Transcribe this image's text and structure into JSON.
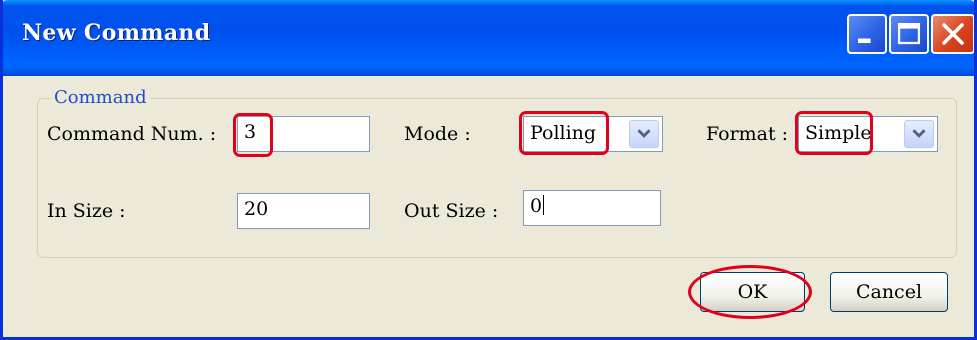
{
  "window": {
    "title": "New Command",
    "controls": [
      "minimize-icon",
      "maximize-icon",
      "close-icon"
    ],
    "colors": {
      "titlebar": "#0050ee",
      "frame": "#ece9d8",
      "highlight": "#e3001b"
    }
  },
  "group": {
    "label": "Command",
    "command_num": {
      "label": "Command Num. :",
      "value": "3"
    },
    "mode": {
      "label": "Mode :",
      "value": "Polling"
    },
    "format": {
      "label": "Format :",
      "value": "Simple"
    },
    "in_size": {
      "label": "In Size :",
      "value": "20"
    },
    "out_size": {
      "label": "Out Size :",
      "value": "0"
    }
  },
  "buttons": {
    "ok": "OK",
    "cancel": "Cancel"
  }
}
